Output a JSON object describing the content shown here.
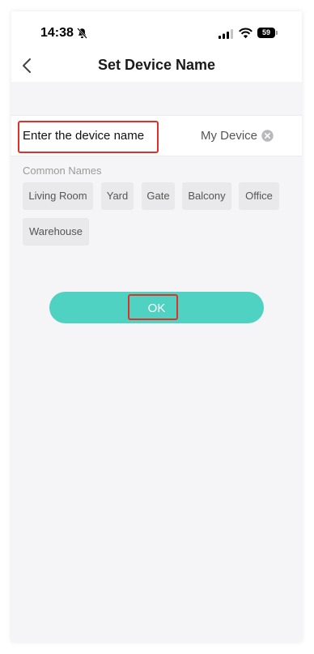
{
  "status_bar": {
    "time": "14:38",
    "battery": "59",
    "icons": [
      "bell-muted-icon",
      "cellular-signal-icon",
      "wifi-icon",
      "battery-icon"
    ]
  },
  "header": {
    "title": "Set Device Name",
    "back_icon": "chevron-left-icon"
  },
  "name_field": {
    "label": "Enter the device name",
    "value": "My Device",
    "clear_icon": "clear-circle-icon"
  },
  "common_names": {
    "title": "Common Names",
    "items": [
      "Living Room",
      "Yard",
      "Gate",
      "Balcony",
      "Office",
      "Warehouse"
    ]
  },
  "actions": {
    "ok_label": "OK"
  },
  "colors": {
    "accent": "#4fd2c2",
    "highlight": "#e0302a",
    "background": "#f5f5f7"
  }
}
